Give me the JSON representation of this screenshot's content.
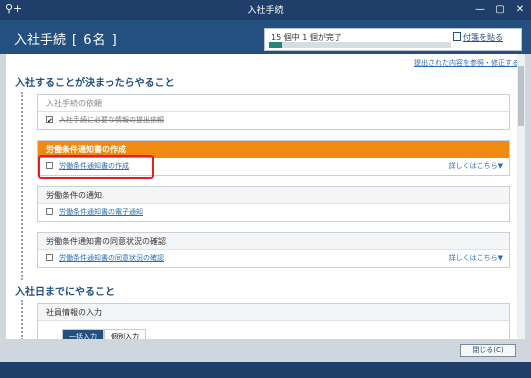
{
  "window": {
    "title": "入社手続",
    "min_icon": "minimize-icon",
    "max_icon": "maximize-icon",
    "close_icon": "close-icon"
  },
  "header": {
    "label": "入社手続",
    "count_text": "[ 6名 ]",
    "progress_text": "15 個中 1 個が完了",
    "progress_fraction": 0.07,
    "attach_label": "付箋を貼る"
  },
  "links": {
    "view_edit": "提出された内容を参照・修正する"
  },
  "sections": [
    {
      "title": "入社することが決まったらやること"
    },
    {
      "title": "入社日までにやること"
    }
  ],
  "cards": [
    {
      "title": "入社手続の依頼",
      "task": "入社手続に必要な情報の提出依頼",
      "checked": true
    },
    {
      "title": "労働条件通知書の作成",
      "task": "労働条件通知書の作成",
      "checked": false,
      "details": "詳しくはこちら▼"
    },
    {
      "title": "労働条件の通知",
      "task": "労働条件通知書の電子通知",
      "checked": false
    },
    {
      "title": "労働条件通知書の同意状況の確認",
      "task": "労働条件通知書の同意状況の確認",
      "checked": false,
      "details": "詳しくはこちら▼"
    },
    {
      "title": "社員情報の入力",
      "tabs": [
        "一括入力",
        "個別入力"
      ]
    }
  ],
  "footer": {
    "close_label": "閉じる(C)"
  }
}
